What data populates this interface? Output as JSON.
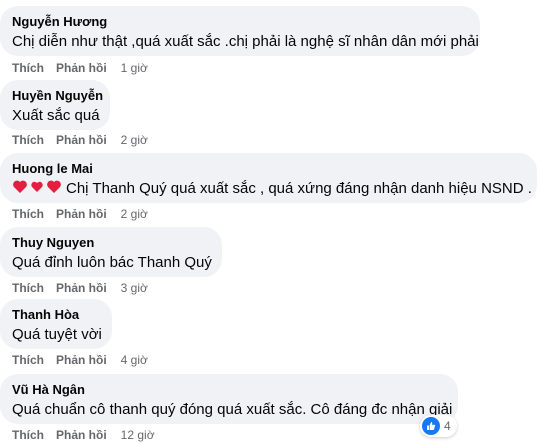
{
  "colors": {
    "bubble": "#f0f2f5",
    "meta": "#65676b",
    "like_blue": "#1877f2",
    "heart": "#e41e3f"
  },
  "actions": {
    "like": "Thích",
    "reply": "Phản hồi"
  },
  "comments": [
    {
      "author": "Nguyễn Hương",
      "text": "Chị diễn như thật ,quá xuất sắc .chị phải là nghệ sĩ nhân dân mới phải",
      "time": "1 giờ"
    },
    {
      "author": "Huyền Nguyễn",
      "text": "Xuất sắc quá",
      "time": "2 giờ"
    },
    {
      "author": "Huong le Mai",
      "text": "Chị Thanh Quý quá xuất sắc , quá xứng đáng nhận danh hiệu NSND .",
      "emoji": "heart-icons",
      "time": "2 giờ"
    },
    {
      "author": "Thuy Nguyen",
      "text": "Quá đỉnh luôn bác Thanh Quý",
      "time": "3 giờ"
    },
    {
      "author": "Thanh Hòa",
      "text": "Quá tuyệt vời",
      "time": "4 giờ"
    },
    {
      "author": "Vũ Hà Ngân",
      "text": "Quá chuẩn cô thanh quý đóng quá xuất sắc. Cô đáng đc nhận giải",
      "time": "12 giờ",
      "reaction_count": "4"
    }
  ]
}
